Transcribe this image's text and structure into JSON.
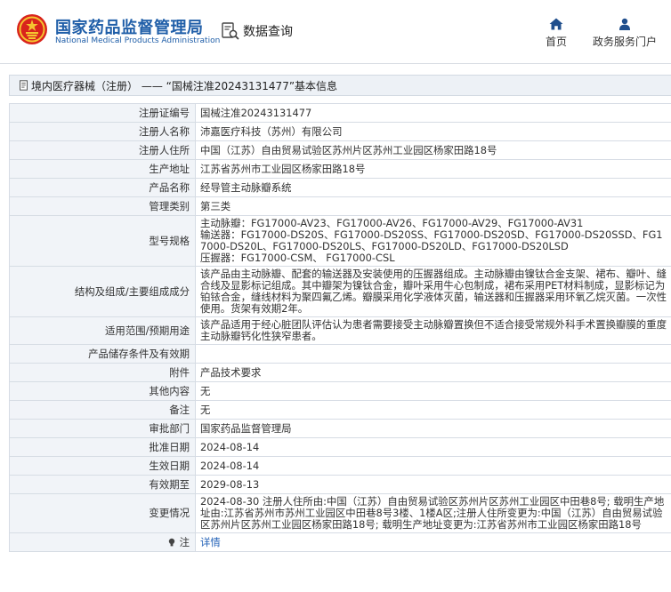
{
  "header": {
    "logo_cn": "国家药品监督管理局",
    "logo_en": "National Medical Products Administration",
    "data_query": "数据查询",
    "nav_home": "首页",
    "nav_gov": "政务服务门户"
  },
  "breadcrumb": {
    "text": "境内医疗器械（注册） —— “国械注准20243131477”基本信息"
  },
  "rows": [
    {
      "label": "注册证编号",
      "value": "国械注准20243131477"
    },
    {
      "label": "注册人名称",
      "value": "沛嘉医疗科技（苏州）有限公司"
    },
    {
      "label": "注册人住所",
      "value": "中国（江苏）自由贸易试验区苏州片区苏州工业园区杨家田路18号"
    },
    {
      "label": "生产地址",
      "value": "江苏省苏州市工业园区杨家田路18号"
    },
    {
      "label": "产品名称",
      "value": "经导管主动脉瓣系统"
    },
    {
      "label": "管理类别",
      "value": "第三类"
    },
    {
      "label": "型号规格",
      "lines": [
        "主动脉瓣：FG17000-AV23、FG17000-AV26、FG17000-AV29、FG17000-AV31",
        "输送器：FG17000-DS20S、FG17000-DS20SS、FG17000-DS20SD、FG17000-DS20SSD、FG17000-DS20L、FG17000-DS20LS、FG17000-DS20LD、FG17000-DS20LSD",
        "压握器：FG17000-CSM、 FG17000-CSL"
      ]
    },
    {
      "label": "结构及组成/主要组成成分",
      "value": "该产品由主动脉瓣、配套的输送器及安装使用的压握器组成。主动脉瓣由镍钛合金支架、裙布、瓣叶、缝合线及显影标记组成。其中瓣架为镍钛合金，瓣叶采用牛心包制成，裙布采用PET材料制成，显影标记为铂铱合金，缝线材料为聚四氟乙烯。瓣膜采用化学液体灭菌，输送器和压握器采用环氧乙烷灭菌。一次性使用。货架有效期2年。"
    },
    {
      "label": "适用范围/预期用途",
      "value": "该产品适用于经心脏团队评估认为患者需要接受主动脉瓣置换但不适合接受常规外科手术置换瓣膜的重度主动脉瓣钙化性狭窄患者。"
    },
    {
      "label": "产品储存条件及有效期",
      "value": ""
    },
    {
      "label": "附件",
      "value": "产品技术要求"
    },
    {
      "label": "其他内容",
      "value": "无"
    },
    {
      "label": "备注",
      "value": "无"
    },
    {
      "label": "审批部门",
      "value": "国家药品监督管理局"
    },
    {
      "label": "批准日期",
      "value": "2024-08-14"
    },
    {
      "label": "生效日期",
      "value": "2024-08-14"
    },
    {
      "label": "有效期至",
      "value": "2029-08-13"
    },
    {
      "label": "变更情况",
      "value": "2024-08-30 注册人住所由:中国（江苏）自由贸易试验区苏州片区苏州工业园区中田巷8号; 载明生产地址由:江苏省苏州市苏州工业园区中田巷8号3楼、1楼A区;注册人住所变更为:中国（江苏）自由贸易试验区苏州片区苏州工业园区杨家田路18号; 载明生产地址变更为:江苏省苏州市工业园区杨家田路18号"
    }
  ],
  "note_row": {
    "label": "注",
    "link": "详情"
  },
  "colors": {
    "brand_blue": "#1f5ea8",
    "link_blue": "#2563b8",
    "label_bg": "#f1f4f8",
    "border": "#d6dce4"
  }
}
